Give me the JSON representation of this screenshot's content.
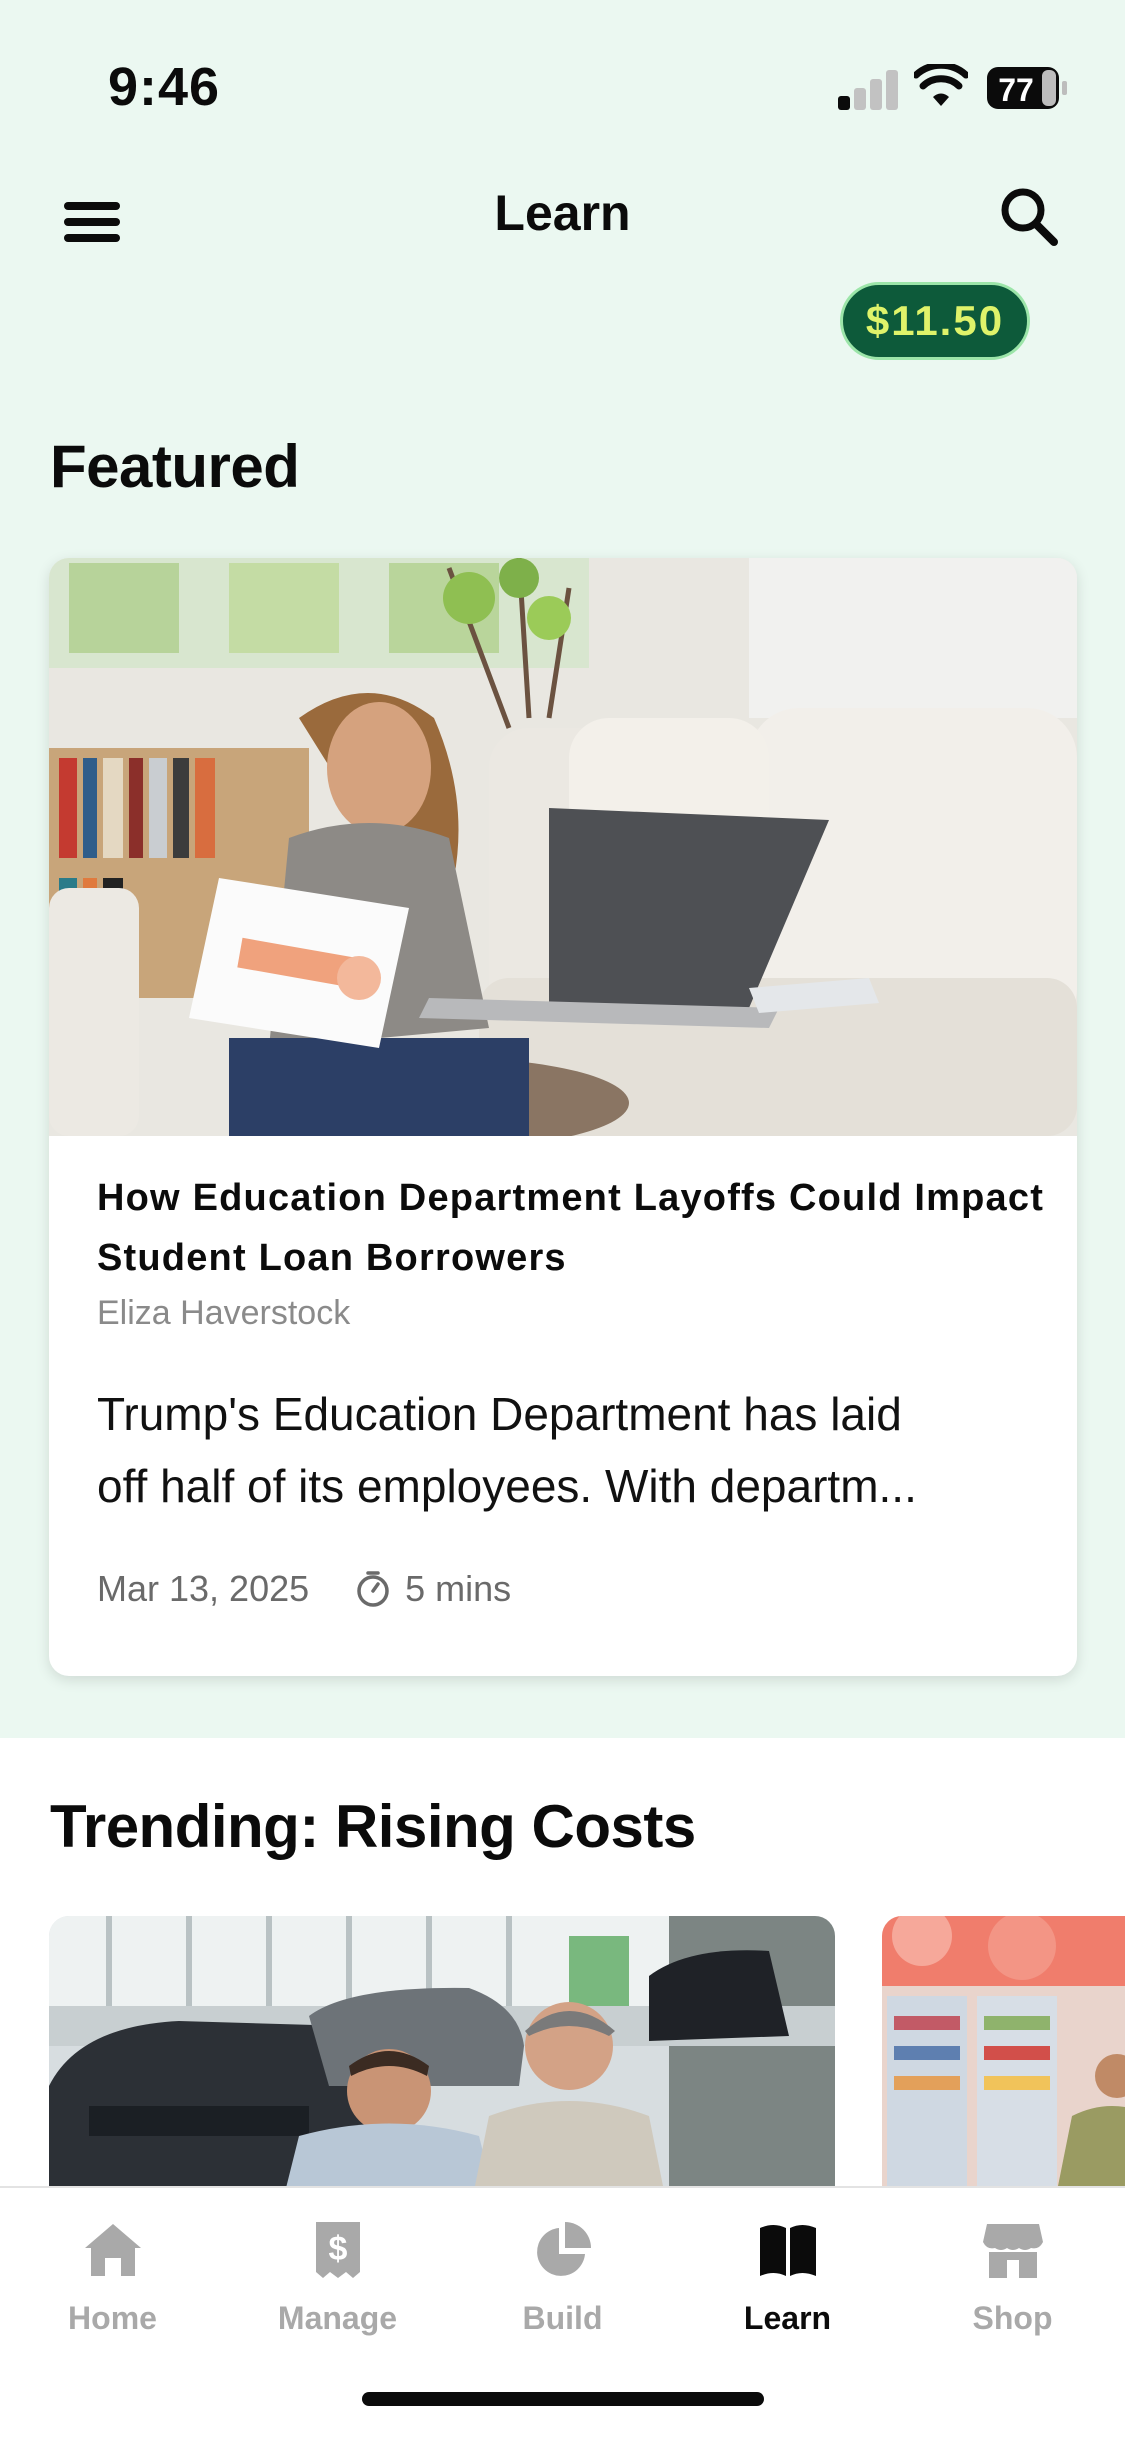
{
  "status_bar": {
    "time": "9:46",
    "battery_level": "77"
  },
  "header": {
    "title": "Learn",
    "balance": "$11.50"
  },
  "featured": {
    "section_title": "Featured",
    "card": {
      "headline": "How Education Department Layoffs Could Impact Student Loan Borrowers",
      "author": "Eliza Haverstock",
      "excerpt_line1": "Trump's Education Department has laid",
      "excerpt_line2": "off half of its employees. With departm...",
      "date": "Mar 13, 2025",
      "read_time": "5 mins"
    }
  },
  "trending": {
    "section_title": "Trending: Rising Costs"
  },
  "tab_bar": {
    "tabs": [
      {
        "label": "Home",
        "icon": "home-icon"
      },
      {
        "label": "Manage",
        "icon": "dollar-document-icon"
      },
      {
        "label": "Build",
        "icon": "pie-chart-icon"
      },
      {
        "label": "Learn",
        "icon": "open-book-icon"
      },
      {
        "label": "Shop",
        "icon": "storefront-icon"
      }
    ],
    "active": "Learn"
  },
  "colors": {
    "background": "#ebf8f1",
    "badge_bg": "#0d5a3a",
    "badge_text": "#dff36a",
    "badge_border": "#9ce5a9",
    "active_tab": "#0b0b0b",
    "inactive_tab": "#a9a9a9"
  }
}
